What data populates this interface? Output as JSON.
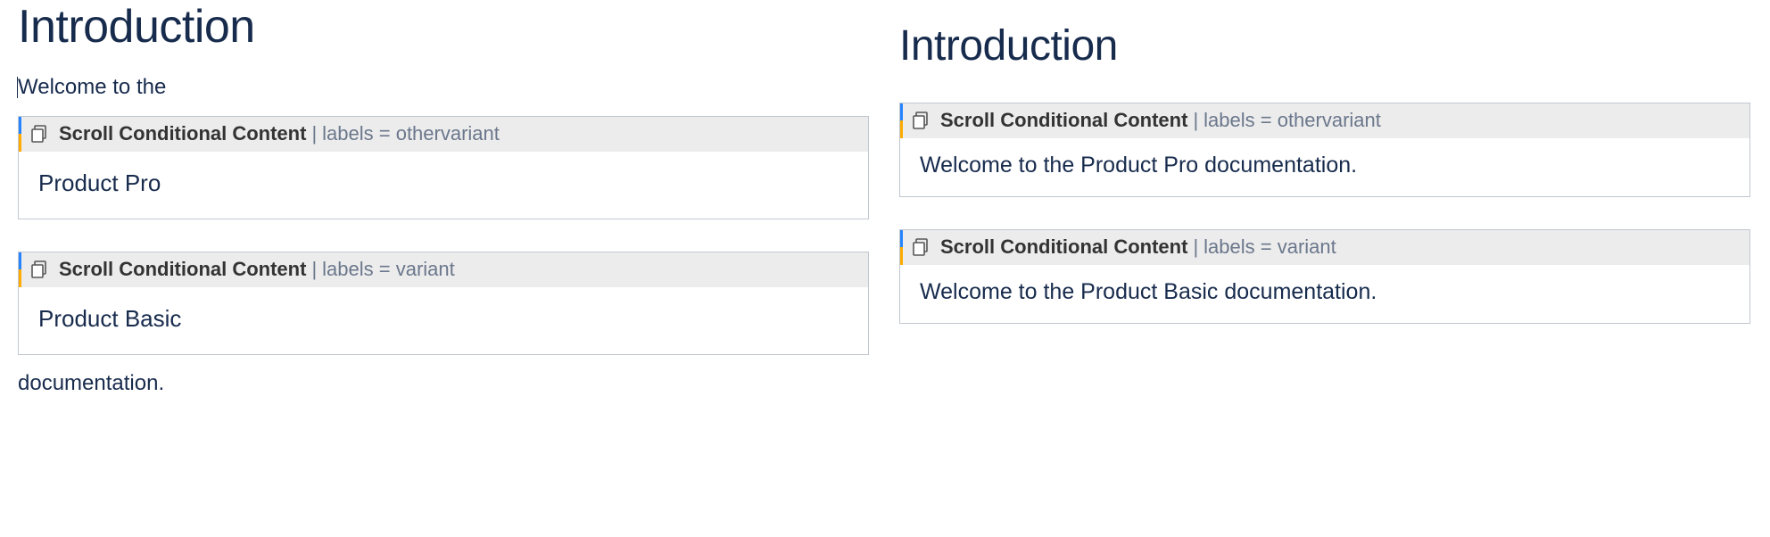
{
  "left": {
    "title": "Introduction",
    "lead": "Welcome to the",
    "macros": [
      {
        "name": "Scroll Conditional Content",
        "params": "labels = othervariant",
        "body": "Product Pro"
      },
      {
        "name": "Scroll Conditional Content",
        "params": "labels = variant",
        "body": "Product Basic"
      }
    ],
    "trailing": "documentation."
  },
  "right": {
    "title": "Introduction",
    "macros": [
      {
        "name": "Scroll Conditional Content",
        "params": "labels = othervariant",
        "body": "Welcome to the Product Pro documentation."
      },
      {
        "name": "Scroll Conditional Content",
        "params": "labels = variant",
        "body": "Welcome to the Product Basic documentation."
      }
    ]
  },
  "macro_separator": "|"
}
